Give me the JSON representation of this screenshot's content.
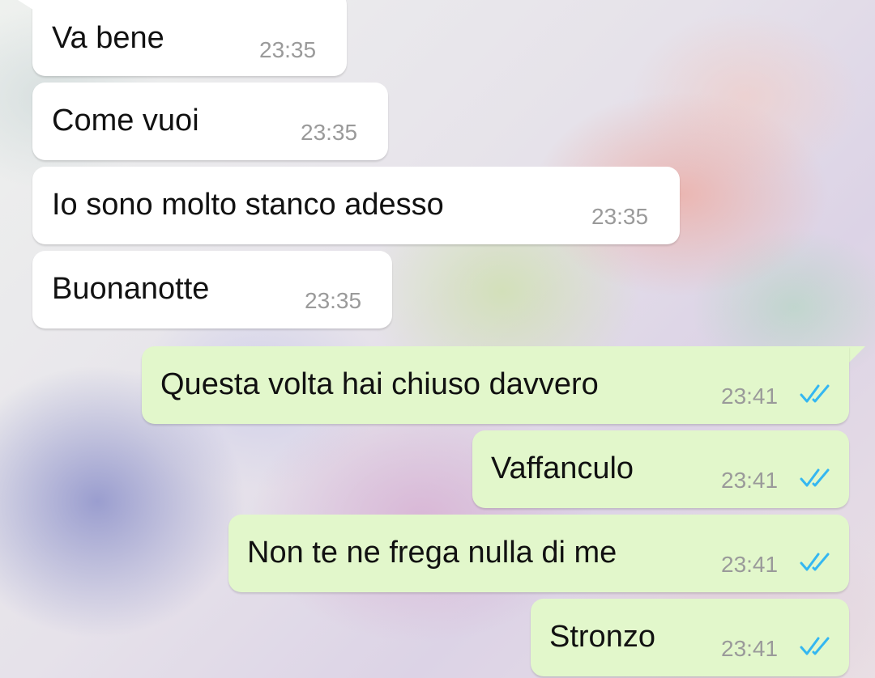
{
  "chat": {
    "messages": [
      {
        "direction": "incoming",
        "text": "Va bene",
        "time": "23:35"
      },
      {
        "direction": "incoming",
        "text": "Come vuoi",
        "time": "23:35"
      },
      {
        "direction": "incoming",
        "text": "Io sono molto stanco adesso",
        "time": "23:35"
      },
      {
        "direction": "incoming",
        "text": "Buonanotte",
        "time": "23:35"
      },
      {
        "direction": "outgoing",
        "text": "Questa volta hai chiuso davvero",
        "time": "23:41",
        "status_icon": "double-check-read-icon"
      },
      {
        "direction": "outgoing",
        "text": "Vaffanculo",
        "time": "23:41",
        "status_icon": "double-check-read-icon"
      },
      {
        "direction": "outgoing",
        "text": "Non te ne frega nulla di me",
        "time": "23:41",
        "status_icon": "double-check-read-icon"
      },
      {
        "direction": "outgoing",
        "text": "Stronzo",
        "time": "23:41",
        "status_icon": "double-check-read-icon"
      }
    ]
  },
  "colors": {
    "incoming_bubble": "#ffffff",
    "outgoing_bubble": "#e2f7cb",
    "read_ticks": "#34b7f1",
    "timestamp": "#9a9a9a"
  }
}
